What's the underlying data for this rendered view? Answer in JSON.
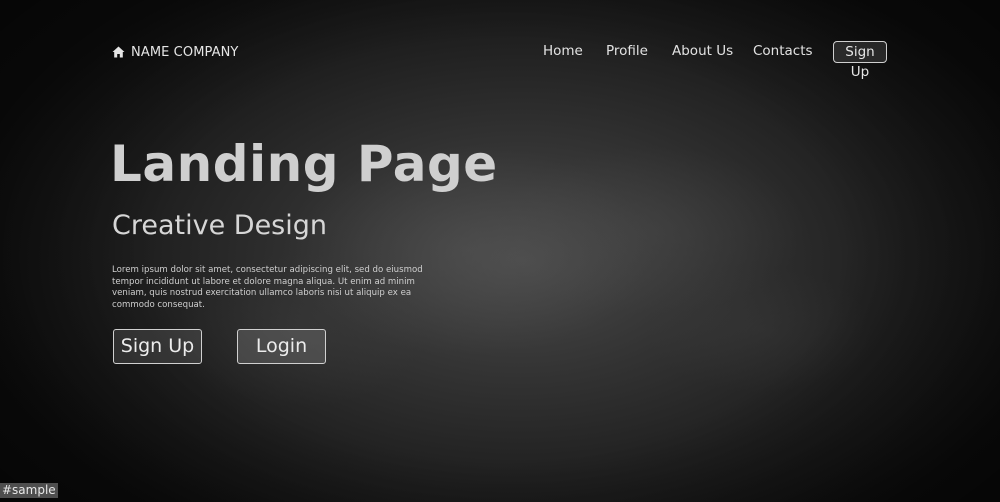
{
  "brand": {
    "icon": "home-icon",
    "name": "NAME COMPANY"
  },
  "nav": {
    "items": [
      {
        "label": "Home"
      },
      {
        "label": "Profile"
      },
      {
        "label": "About Us"
      },
      {
        "label": "Contacts"
      }
    ],
    "signup_label": "Sign Up"
  },
  "hero": {
    "title": "Landing Page",
    "subtitle": "Creative Design",
    "body": "Lorem ipsum dolor sit amet, consectetur adipiscing elit, sed do eiusmod tempor incididunt ut labore et dolore magna aliqua. Ut enim ad minim veniam, quis nostrud exercitation ullamco laboris nisi ut aliquip ex ea commodo consequat.",
    "signup_label": "Sign Up",
    "login_label": "Login"
  },
  "watermark": "#sample",
  "colors": {
    "background": "#1b1b1b",
    "text": "#d8d8d8",
    "button_border": "#d0d0d0"
  }
}
